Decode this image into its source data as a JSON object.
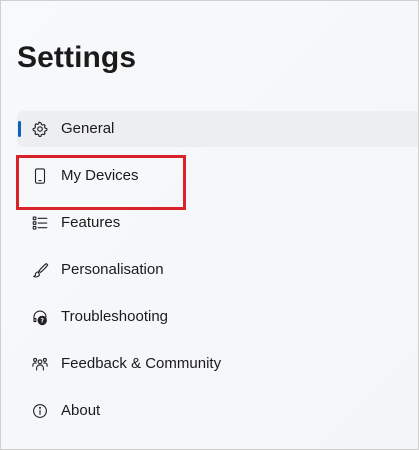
{
  "page": {
    "title": "Settings"
  },
  "nav": {
    "items": [
      {
        "label": "General",
        "icon": "gear-icon",
        "selected": true
      },
      {
        "label": "My Devices",
        "icon": "phone-icon",
        "selected": false
      },
      {
        "label": "Features",
        "icon": "list-icon",
        "selected": false
      },
      {
        "label": "Personalisation",
        "icon": "brush-icon",
        "selected": false
      },
      {
        "label": "Troubleshooting",
        "icon": "troubleshoot-icon",
        "selected": false
      },
      {
        "label": "Feedback & Community",
        "icon": "people-icon",
        "selected": false
      },
      {
        "label": "About",
        "icon": "info-icon",
        "selected": false
      }
    ]
  },
  "colors": {
    "accent": "#0f5fbf",
    "highlight": "#d8232a",
    "selected_bg": "#eceef1"
  }
}
